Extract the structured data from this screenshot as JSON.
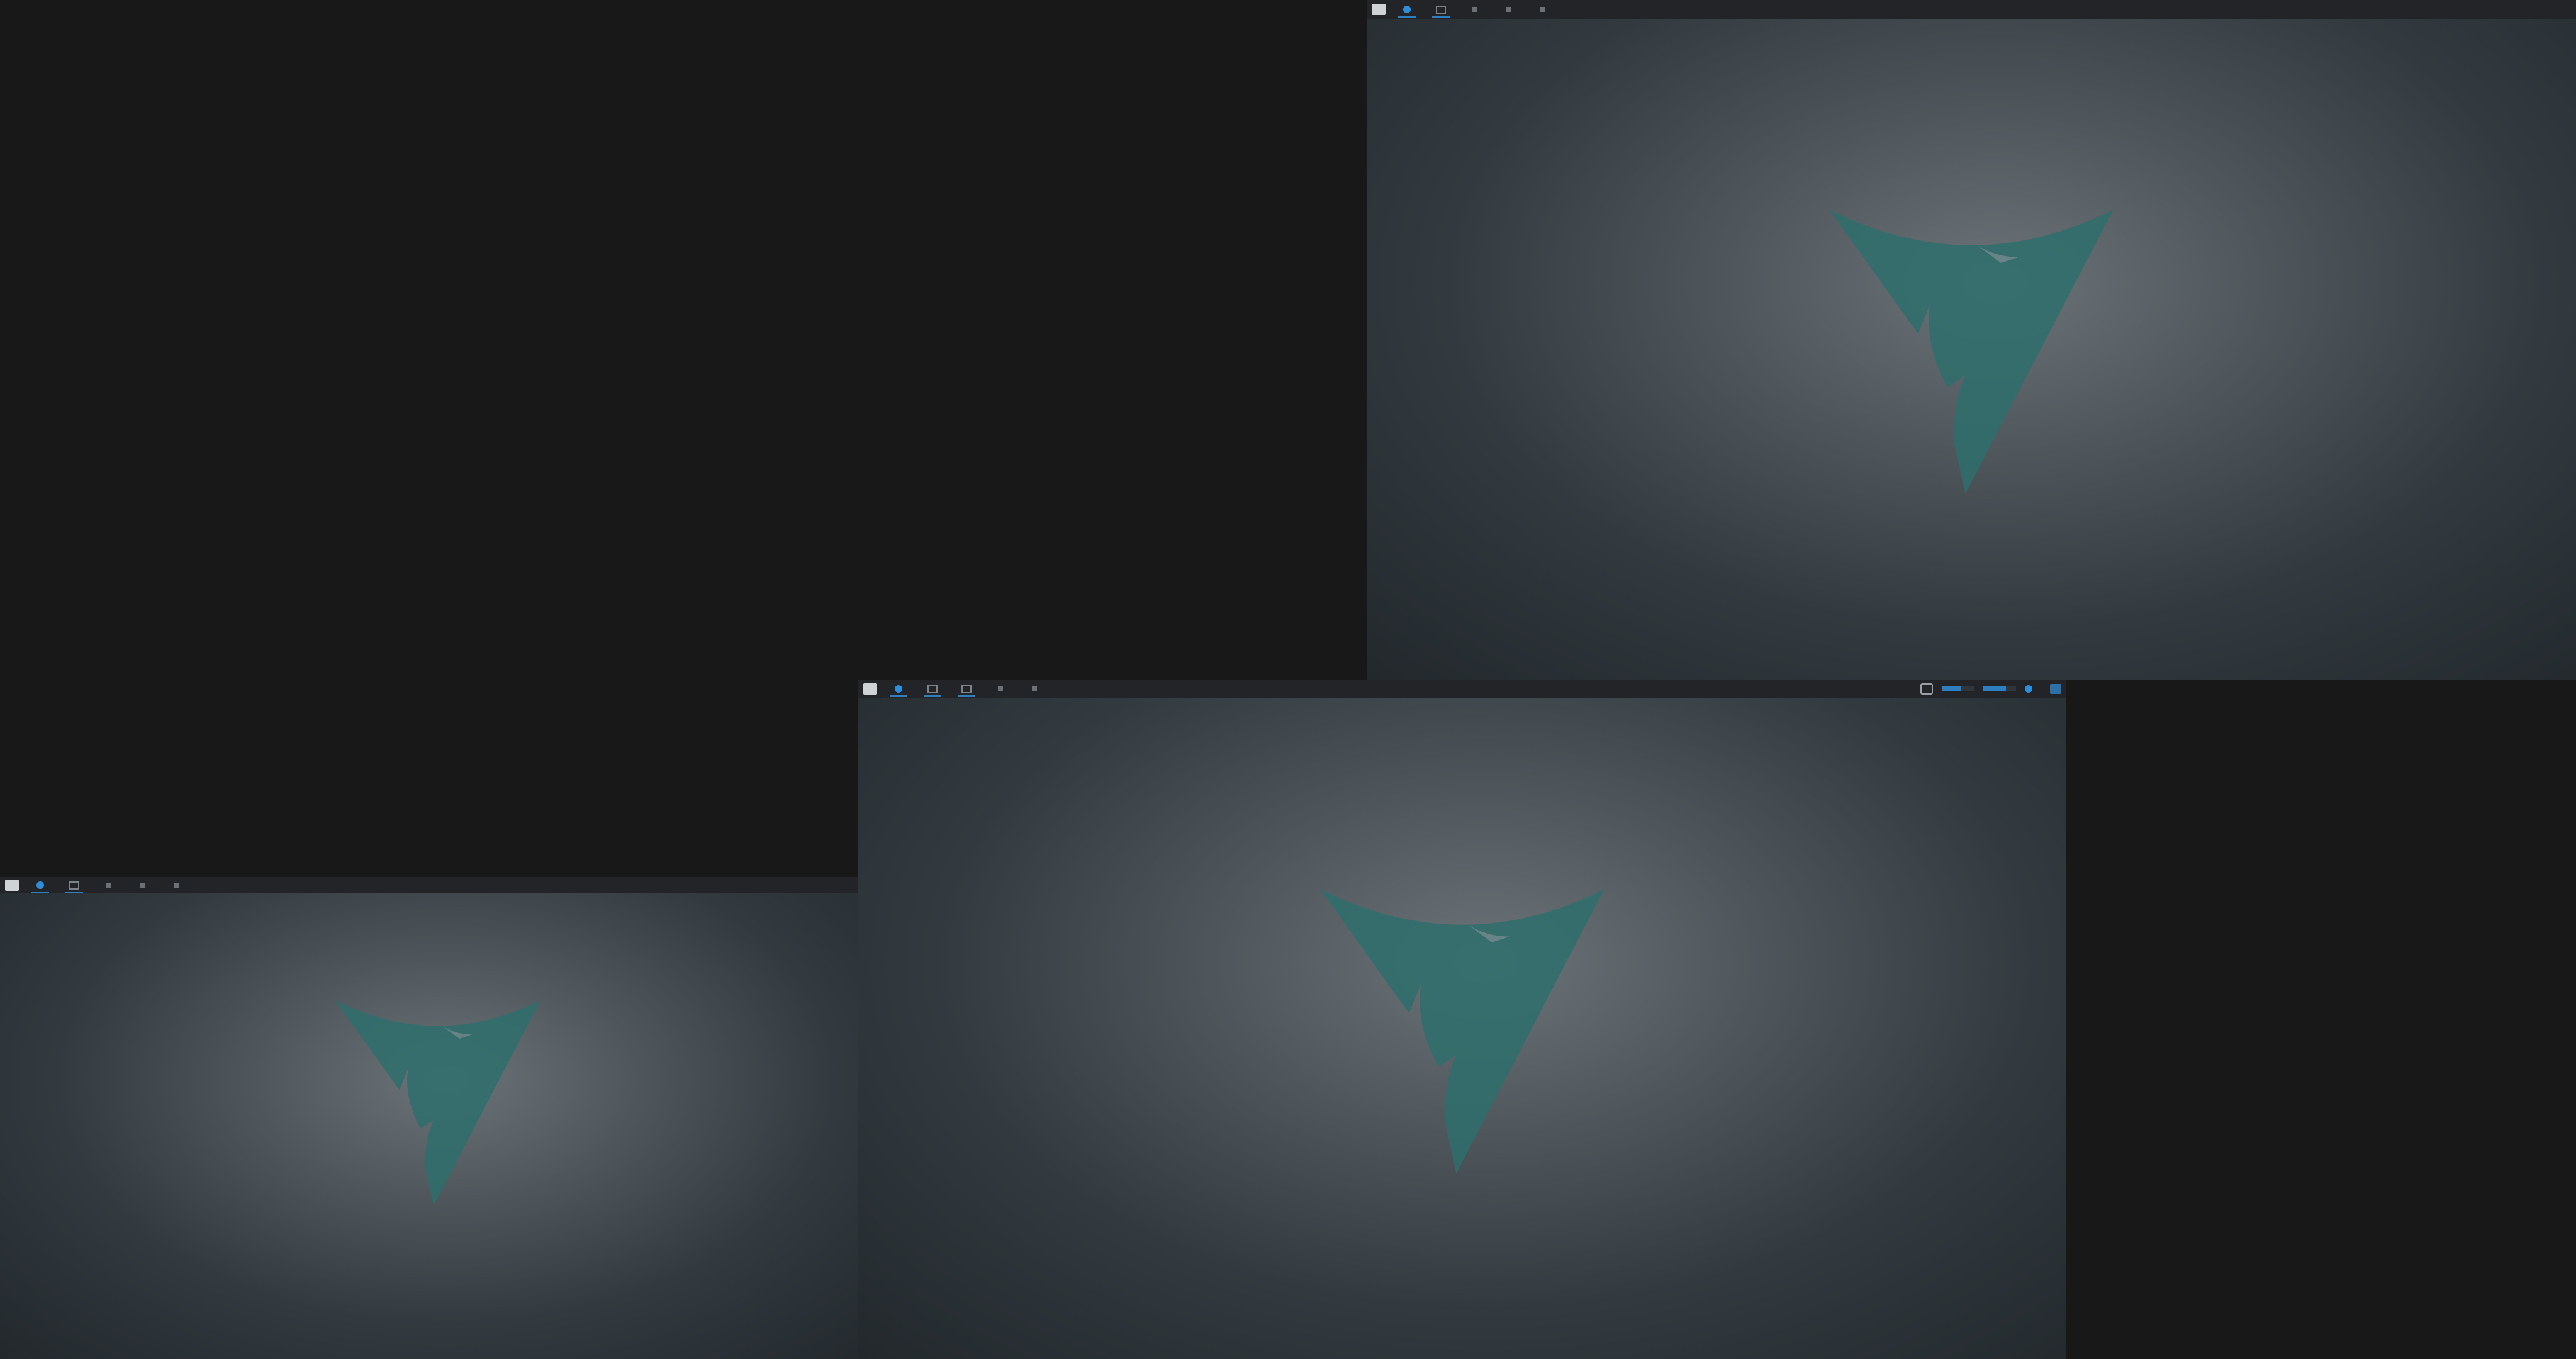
{
  "desktop": {
    "monitors": [
      {
        "id": "monitor-top-right",
        "workspaces": [
          {
            "label": "",
            "icon": "dot",
            "active": true
          },
          {
            "label": "",
            "icon": "square",
            "active": true
          },
          {
            "label": "",
            "icon": "small",
            "active": false
          },
          {
            "label": "",
            "icon": "small",
            "active": false
          },
          {
            "label": "",
            "icon": "small",
            "active": false
          }
        ]
      },
      {
        "id": "monitor-center",
        "workspaces": [
          {
            "label": "",
            "icon": "dot",
            "active": true
          },
          {
            "label": "",
            "icon": "square",
            "active": true
          },
          {
            "label": "",
            "icon": "square",
            "active": true
          },
          {
            "label": "",
            "icon": "small",
            "active": false
          },
          {
            "label": "",
            "icon": "small",
            "active": false
          }
        ],
        "tray": {
          "clock": "",
          "volume_level": 0.6,
          "network_level": 0.7
        }
      },
      {
        "id": "monitor-bottom-left",
        "workspaces": [
          {
            "label": "",
            "icon": "dot",
            "active": true
          },
          {
            "label": "",
            "icon": "square",
            "active": true
          },
          {
            "label": "",
            "icon": "small",
            "active": false
          },
          {
            "label": "",
            "icon": "small",
            "active": false
          },
          {
            "label": "",
            "icon": "small",
            "active": false
          }
        ]
      }
    ],
    "colors": {
      "background": "#181819",
      "bar": "#232427",
      "accent": "#2d7fbf",
      "logo": "#2e6f6c"
    },
    "icons": {
      "app_menu": "app-menu-icon",
      "logo": "triangle-claw-logo"
    }
  }
}
